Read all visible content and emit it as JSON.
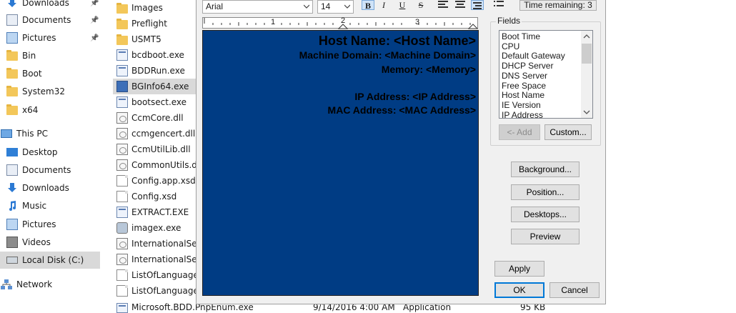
{
  "explorer": {
    "nav": [
      {
        "label": "Downloads",
        "icon": "download-arrow-icon",
        "pinned": true
      },
      {
        "label": "Documents",
        "icon": "documents-icon",
        "pinned": true
      },
      {
        "label": "Pictures",
        "icon": "pictures-icon",
        "pinned": true
      },
      {
        "label": "Bin",
        "icon": "folder-icon",
        "pinned": false
      },
      {
        "label": "Boot",
        "icon": "folder-icon",
        "pinned": false
      },
      {
        "label": "System32",
        "icon": "folder-icon",
        "pinned": false
      },
      {
        "label": "x64",
        "icon": "folder-icon",
        "pinned": false
      },
      {
        "label": "This PC",
        "icon": "computer-icon",
        "pinned": false
      },
      {
        "label": "Desktop",
        "icon": "desktop-icon",
        "pinned": false
      },
      {
        "label": "Documents",
        "icon": "documents-icon",
        "pinned": false
      },
      {
        "label": "Downloads",
        "icon": "download-arrow-icon",
        "pinned": false
      },
      {
        "label": "Music",
        "icon": "music-icon",
        "pinned": false
      },
      {
        "label": "Pictures",
        "icon": "pictures-icon",
        "pinned": false
      },
      {
        "label": "Videos",
        "icon": "videos-icon",
        "pinned": false
      },
      {
        "label": "Local Disk (C:)",
        "icon": "drive-icon",
        "pinned": false
      },
      {
        "label": "Network",
        "icon": "network-icon",
        "pinned": false
      }
    ],
    "pin_glyph": "📌",
    "files": [
      {
        "name": "Images",
        "icon": "folder-icon"
      },
      {
        "name": "Preflight",
        "icon": "folder-icon"
      },
      {
        "name": "USMT5",
        "icon": "folder-icon"
      },
      {
        "name": "bcdboot.exe",
        "icon": "exe-icon"
      },
      {
        "name": "BDDRun.exe",
        "icon": "window-exe-icon"
      },
      {
        "name": "BGInfo64.exe",
        "icon": "bginfo-icon"
      },
      {
        "name": "bootsect.exe",
        "icon": "exe-icon"
      },
      {
        "name": "CcmCore.dll",
        "icon": "dll-icon"
      },
      {
        "name": "ccmgencert.dll",
        "icon": "dll-icon"
      },
      {
        "name": "CcmUtilLib.dll",
        "icon": "dll-icon"
      },
      {
        "name": "CommonUtils.dll",
        "icon": "dll-icon"
      },
      {
        "name": "Config.app.xsd",
        "icon": "document-icon"
      },
      {
        "name": "Config.xsd",
        "icon": "document-icon"
      },
      {
        "name": "EXTRACT.EXE",
        "icon": "window-exe-icon"
      },
      {
        "name": "imagex.exe",
        "icon": "imagex-icon"
      },
      {
        "name": "InternationalSettings",
        "icon": "dll-icon"
      },
      {
        "name": "InternationalSettings",
        "icon": "dll-icon"
      },
      {
        "name": "ListOfLanguages",
        "icon": "document-icon"
      },
      {
        "name": "ListOfLanguages",
        "icon": "document-icon"
      }
    ],
    "detail_row": {
      "name": "Microsoft.BDD.PnpEnum.exe",
      "date": "9/14/2016 4:00 AM",
      "type": "Application",
      "size": "95 KB"
    }
  },
  "bginfo": {
    "font_name": "Arial",
    "font_size": "14",
    "format_buttons": {
      "bold": "B",
      "italic": "I",
      "underline": "U",
      "strike": "S"
    },
    "timer": "Time remaining: 3",
    "ruler_labels": [
      "1",
      "2",
      "3"
    ],
    "editor_background": "#003c84",
    "editor_lines": [
      {
        "text": "Host Name: <Host Name>",
        "size": "big"
      },
      {
        "text": "Machine Domain: <Machine Domain>",
        "size": "small"
      },
      {
        "text": "Memory: <Memory>",
        "size": "small"
      },
      {
        "text": "",
        "size": "small"
      },
      {
        "text": "IP Address: <IP Address>",
        "size": "small"
      },
      {
        "text": "MAC Address: <MAC Address>",
        "size": "small"
      }
    ],
    "fields_title": "Fields",
    "fields": [
      "Boot Time",
      "CPU",
      "Default Gateway",
      "DHCP Server",
      "DNS Server",
      "Free Space",
      "Host Name",
      "IE Version",
      "IP Address"
    ],
    "add_button": "<- Add",
    "custom_button": "Custom...",
    "background_button": "Background...",
    "position_button": "Position...",
    "desktops_button": "Desktops...",
    "preview_button": "Preview",
    "apply_button": "Apply",
    "ok_button": "OK",
    "cancel_button": "Cancel"
  }
}
